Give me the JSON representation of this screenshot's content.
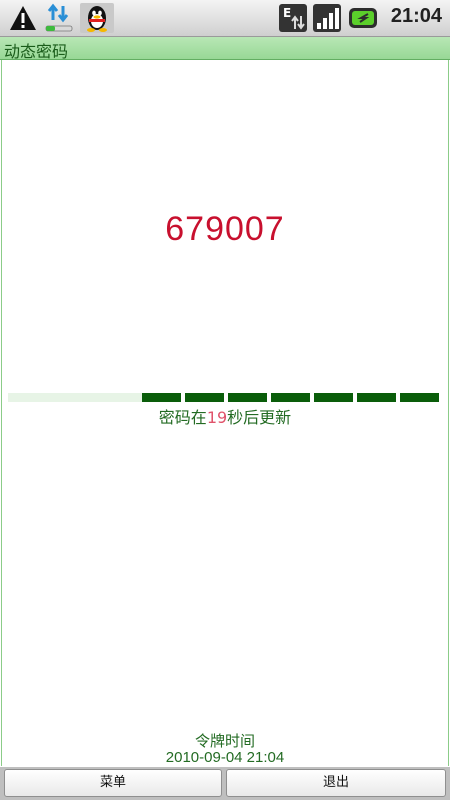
{
  "status_bar": {
    "time": "21:04",
    "network_type_label": "E",
    "icons": [
      "warning-icon",
      "sync-icon",
      "qq-penguin-icon",
      "edge-network-icon",
      "signal-strength-icon",
      "battery-charging-icon"
    ]
  },
  "app": {
    "title": "动态密码"
  },
  "main": {
    "password": "679007",
    "countdown_prefix": "密码在",
    "countdown_seconds": "19",
    "countdown_suffix": "秒后更新",
    "progress": {
      "filled_segments": 7,
      "total_segments": 10,
      "remaining_fraction": 0.63
    },
    "token_time_label": "令牌时间",
    "token_time_value": "2010-09-04 21:04"
  },
  "buttons": {
    "menu": "菜单",
    "exit": "退出"
  },
  "colors": {
    "title_bar": "#a8e0a5",
    "password": "#c8102e",
    "progress_filled": "#0a5d0a",
    "progress_empty": "#e7f4e6",
    "text_green": "#236b23",
    "seconds": "#e0536b"
  }
}
